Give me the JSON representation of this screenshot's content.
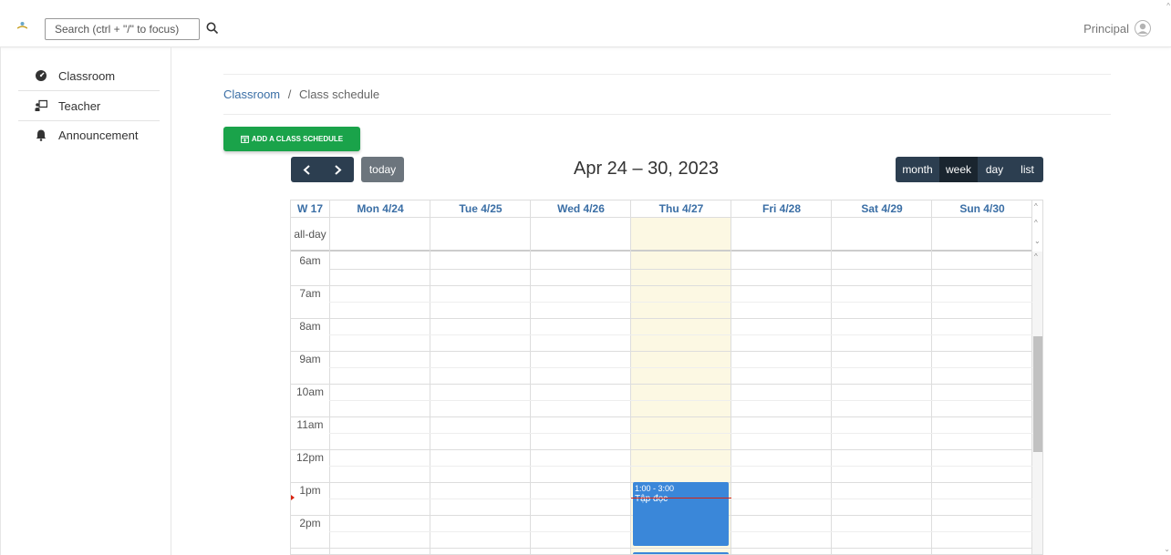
{
  "header": {
    "search_placeholder": "Search (ctrl + \"/\" to focus)",
    "user_name": "Principal"
  },
  "sidebar": {
    "items": [
      {
        "label": "Classroom",
        "icon": "gauge-icon"
      },
      {
        "label": "Teacher",
        "icon": "teacher-icon"
      },
      {
        "label": "Announcement",
        "icon": "bell-icon"
      }
    ]
  },
  "breadcrumb": {
    "parent": "Classroom",
    "separator": "/",
    "current": "Class schedule"
  },
  "actions": {
    "add_schedule": "ADD A CLASS SCHEDULE"
  },
  "calendar": {
    "title": "Apr 24 – 30, 2023",
    "today_label": "today",
    "views": [
      "month",
      "week",
      "day",
      "list"
    ],
    "active_view": "week",
    "week_label": "W 17",
    "days": [
      "Mon 4/24",
      "Tue 4/25",
      "Wed 4/26",
      "Thu 4/27",
      "Fri 4/28",
      "Sat 4/29",
      "Sun 4/30"
    ],
    "today_index": 3,
    "all_day_label": "all-day",
    "hours": [
      "6am",
      "7am",
      "8am",
      "9am",
      "10am",
      "11am",
      "12pm",
      "1pm",
      "2pm"
    ],
    "events": [
      {
        "day": "Thu 4/27",
        "time": "1:00 - 3:00",
        "title": "Tập đọc"
      }
    ]
  },
  "colors": {
    "accent": "#3a6ea5",
    "add_button": "#1aa34a",
    "toolbar_dark": "#2c3e50",
    "event": "#3a87d9",
    "today_bg": "#fcf8e3"
  }
}
